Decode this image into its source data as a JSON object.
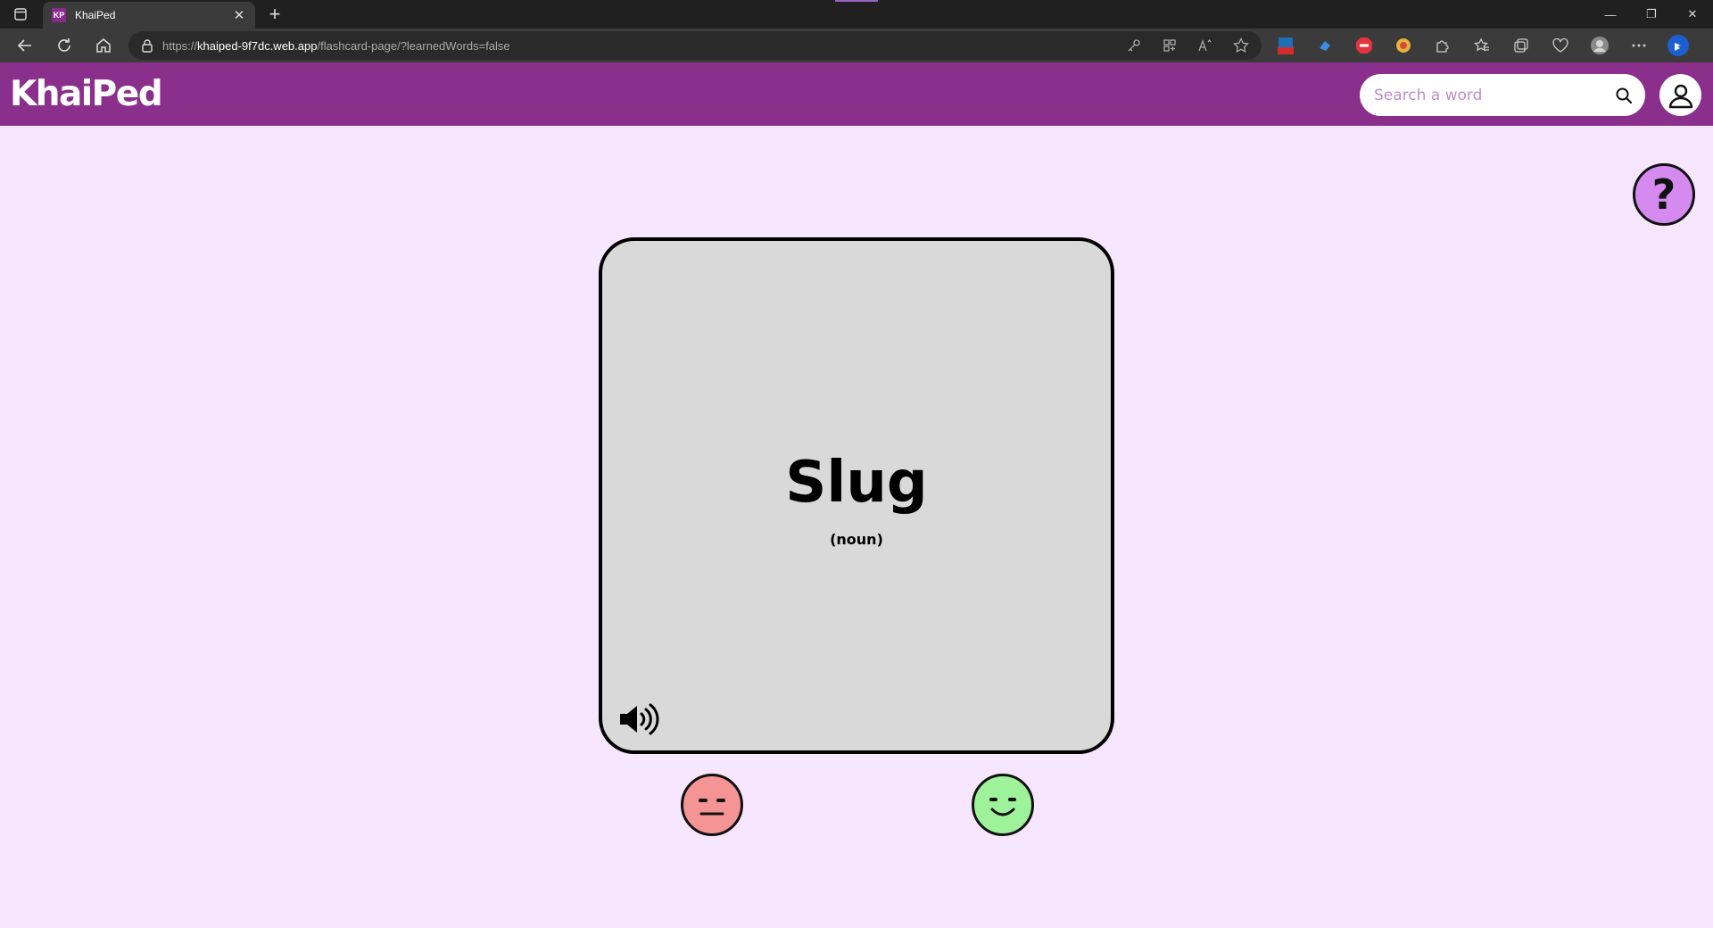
{
  "browser": {
    "tab": {
      "favicon_text": "KP",
      "title": "KhaiPed",
      "close_glyph": "✕"
    },
    "new_tab_glyph": "+",
    "address": {
      "scheme": "https://",
      "host": "khaiped-9f7dc.web.app",
      "path": "/flashcard-page/?learnedWords=false"
    },
    "window_controls": {
      "minimize": "—",
      "restore": "❐",
      "close": "✕"
    }
  },
  "header": {
    "logo": "KhaiPed",
    "search": {
      "placeholder": "Search a word",
      "value": ""
    },
    "brand_color": "#8a2f8c"
  },
  "help": {
    "label": "?"
  },
  "flashcard": {
    "word": "Slug",
    "part_of_speech": "(noun)"
  },
  "feedback": {
    "not_learned_color": "#f59494",
    "learned_color": "#9df29a"
  },
  "icons": {
    "search": "search-icon",
    "user": "user-icon",
    "speaker": "speaker-icon",
    "neutral": "neutral-face-icon",
    "smile": "smile-face-icon"
  }
}
